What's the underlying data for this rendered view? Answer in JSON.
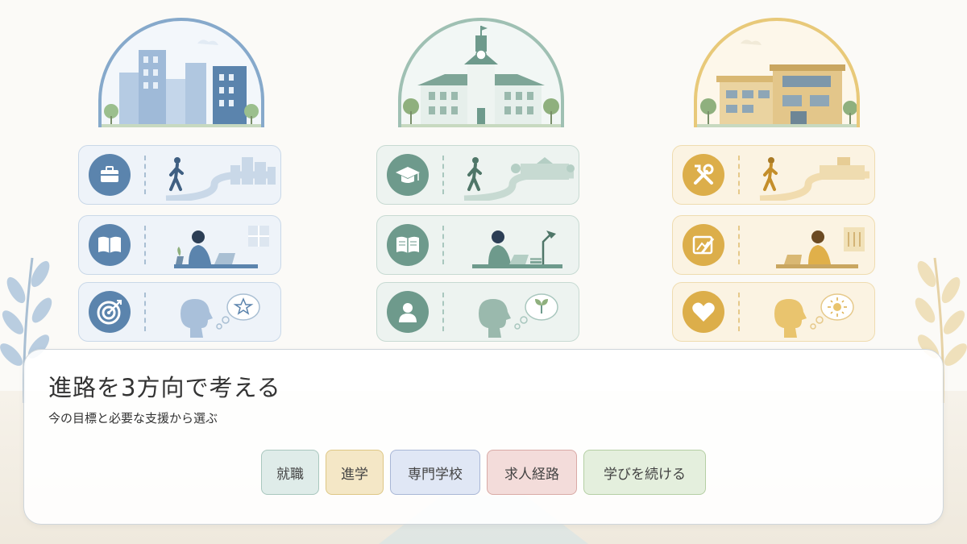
{
  "panel": {
    "title": "進路を3方向で考える",
    "subtitle": "今の目標と必要な支援から選ぶ"
  },
  "options": [
    {
      "label": "就職",
      "bg": "#dfece9",
      "border": "#a9c7be"
    },
    {
      "label": "進学",
      "bg": "#f4e7c6",
      "border": "#dec785"
    },
    {
      "label": "専門学校",
      "bg": "#e0e7f5",
      "border": "#a9b7d6"
    },
    {
      "label": "求人経路",
      "bg": "#f3dcda",
      "border": "#d9aaa6"
    },
    {
      "label": "学びを続ける",
      "bg": "#e4efdd",
      "border": "#b5cfa4"
    }
  ],
  "columns": [
    {
      "id": "employment",
      "accent": "#5b84ad",
      "card_bg": "#eef3f9",
      "card_border": "#c9d8e8",
      "icons": [
        "briefcase-icon",
        "open-book-icon",
        "target-icon"
      ]
    },
    {
      "id": "higher-education",
      "accent": "#6e9a8c",
      "card_bg": "#edf3f0",
      "card_border": "#c7dad2",
      "icons": [
        "graduation-cap-icon",
        "open-book-icon",
        "person-icon"
      ]
    },
    {
      "id": "vocational-school",
      "accent": "#dcae4a",
      "card_bg": "#fbf3e2",
      "card_border": "#efdcb0",
      "icons": [
        "tools-icon",
        "drawing-icon",
        "heart-icon"
      ]
    }
  ]
}
